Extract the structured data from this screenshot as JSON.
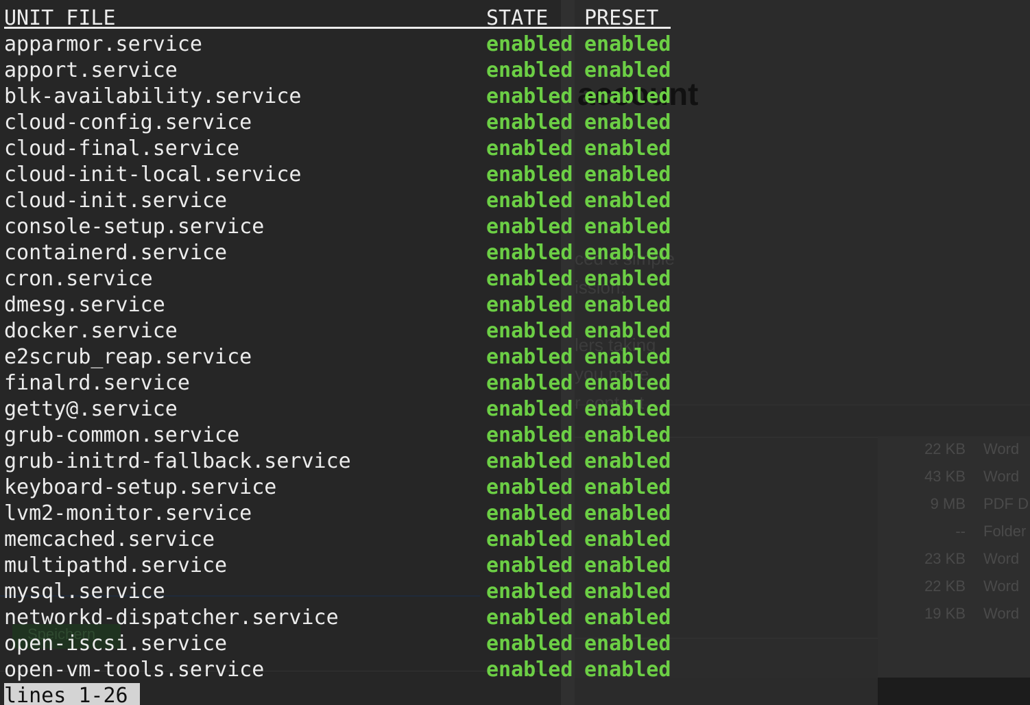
{
  "background": {
    "doc_fragments": [
      "account",
      "ced a simple",
      "ission.",
      "lers taking",
      "you more",
      "r content"
    ],
    "button_label": "Speichern",
    "file_rows": [
      {
        "size": "22 KB",
        "kind": "Word"
      },
      {
        "size": "43 KB",
        "kind": "Word"
      },
      {
        "size": "9 MB",
        "kind": "PDF D"
      },
      {
        "size": "--",
        "kind": "Folder"
      },
      {
        "size": "23 KB",
        "kind": "Word"
      },
      {
        "size": "22 KB",
        "kind": "Word"
      },
      {
        "size": "19 KB",
        "kind": "Word"
      }
    ]
  },
  "terminal": {
    "header": {
      "unit": "UNIT FILE",
      "state": "STATE",
      "preset": "PRESET"
    },
    "rows": [
      {
        "unit": "apparmor.service",
        "state": "enabled",
        "preset": "enabled"
      },
      {
        "unit": "apport.service",
        "state": "enabled",
        "preset": "enabled"
      },
      {
        "unit": "blk-availability.service",
        "state": "enabled",
        "preset": "enabled"
      },
      {
        "unit": "cloud-config.service",
        "state": "enabled",
        "preset": "enabled"
      },
      {
        "unit": "cloud-final.service",
        "state": "enabled",
        "preset": "enabled"
      },
      {
        "unit": "cloud-init-local.service",
        "state": "enabled",
        "preset": "enabled"
      },
      {
        "unit": "cloud-init.service",
        "state": "enabled",
        "preset": "enabled"
      },
      {
        "unit": "console-setup.service",
        "state": "enabled",
        "preset": "enabled"
      },
      {
        "unit": "containerd.service",
        "state": "enabled",
        "preset": "enabled"
      },
      {
        "unit": "cron.service",
        "state": "enabled",
        "preset": "enabled"
      },
      {
        "unit": "dmesg.service",
        "state": "enabled",
        "preset": "enabled"
      },
      {
        "unit": "docker.service",
        "state": "enabled",
        "preset": "enabled"
      },
      {
        "unit": "e2scrub_reap.service",
        "state": "enabled",
        "preset": "enabled"
      },
      {
        "unit": "finalrd.service",
        "state": "enabled",
        "preset": "enabled"
      },
      {
        "unit": "getty@.service",
        "state": "enabled",
        "preset": "enabled"
      },
      {
        "unit": "grub-common.service",
        "state": "enabled",
        "preset": "enabled"
      },
      {
        "unit": "grub-initrd-fallback.service",
        "state": "enabled",
        "preset": "enabled"
      },
      {
        "unit": "keyboard-setup.service",
        "state": "enabled",
        "preset": "enabled"
      },
      {
        "unit": "lvm2-monitor.service",
        "state": "enabled",
        "preset": "enabled"
      },
      {
        "unit": "memcached.service",
        "state": "enabled",
        "preset": "enabled"
      },
      {
        "unit": "multipathd.service",
        "state": "enabled",
        "preset": "enabled"
      },
      {
        "unit": "mysql.service",
        "state": "enabled",
        "preset": "enabled"
      },
      {
        "unit": "networkd-dispatcher.service",
        "state": "enabled",
        "preset": "enabled"
      },
      {
        "unit": "open-iscsi.service",
        "state": "enabled",
        "preset": "enabled"
      },
      {
        "unit": "open-vm-tools.service",
        "state": "enabled",
        "preset": "enabled"
      }
    ],
    "pager_status": "lines 1-26"
  },
  "colors": {
    "background": "#262626",
    "text": "#ececec",
    "enabled": "#6ccf45",
    "pager_bg": "#d4d4d4"
  }
}
